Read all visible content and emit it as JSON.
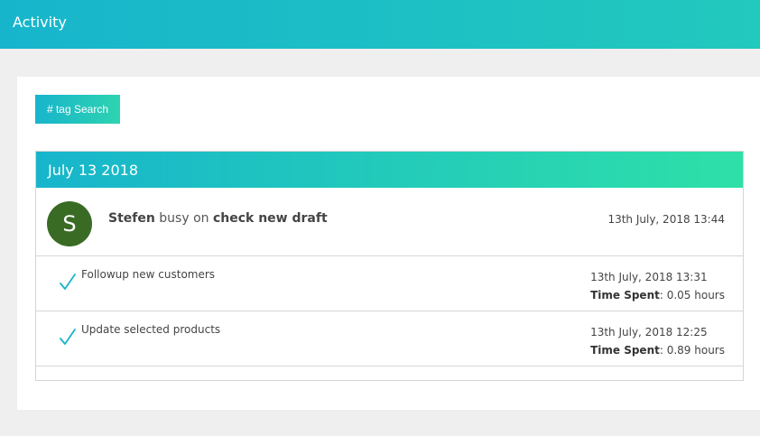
{
  "header": {
    "title": "Activity"
  },
  "toolbar": {
    "tag_search_label": "# tag Search"
  },
  "group": {
    "date": "July 13 2018",
    "entry": {
      "avatar_initial": "S",
      "user": "Stefen",
      "verb": "busy on",
      "target": "check new draft",
      "timestamp": "13th July, 2018 13:44"
    },
    "tasks": [
      {
        "label": "Followup new customers",
        "timestamp": "13th July, 2018 13:31",
        "time_spent_label": "Time Spent",
        "time_spent_value": ": 0.05 hours",
        "icon": "check-icon"
      },
      {
        "label": "Update selected products",
        "timestamp": "13th July, 2018 12:25",
        "time_spent_label": "Time Spent",
        "time_spent_value": ": 0.89 hours",
        "icon": "check-icon"
      }
    ]
  },
  "colors": {
    "accent_start": "#17b5cc",
    "accent_end": "#2ee0a8",
    "avatar_bg": "#3a6b25",
    "check": "#19b3c9"
  }
}
